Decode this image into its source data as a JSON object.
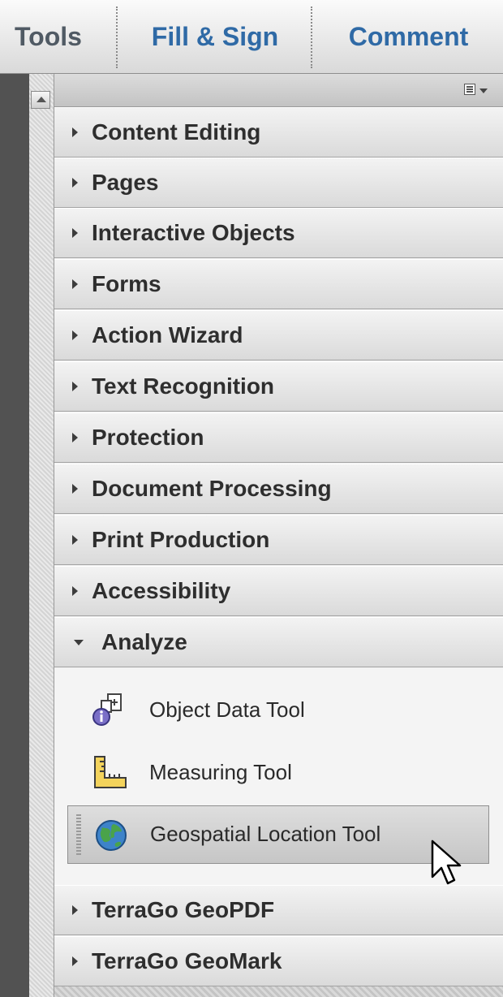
{
  "tabs": [
    {
      "label": "Tools"
    },
    {
      "label": "Fill & Sign"
    },
    {
      "label": "Comment"
    }
  ],
  "panel": {
    "options_icon": "panel-options-icon",
    "sections_top": [
      {
        "label": "Content Editing"
      },
      {
        "label": "Pages"
      },
      {
        "label": "Interactive Objects"
      },
      {
        "label": "Forms"
      },
      {
        "label": "Action Wizard"
      },
      {
        "label": "Text Recognition"
      },
      {
        "label": "Protection"
      },
      {
        "label": "Document Processing"
      },
      {
        "label": "Print Production"
      },
      {
        "label": "Accessibility"
      }
    ],
    "open_section": {
      "label": "Analyze",
      "tools": [
        {
          "label": "Object Data Tool",
          "icon": "object-data-icon"
        },
        {
          "label": "Measuring Tool",
          "icon": "ruler-icon"
        },
        {
          "label": "Geospatial Location Tool",
          "icon": "globe-icon",
          "selected": true
        }
      ]
    },
    "sections_bottom": [
      {
        "label": "TerraGo GeoPDF"
      },
      {
        "label": "TerraGo GeoMark"
      }
    ]
  },
  "colors": {
    "tab_blue": "#2f6aa6",
    "tab_gray": "#505a64",
    "section_text": "#2e2e2e"
  }
}
